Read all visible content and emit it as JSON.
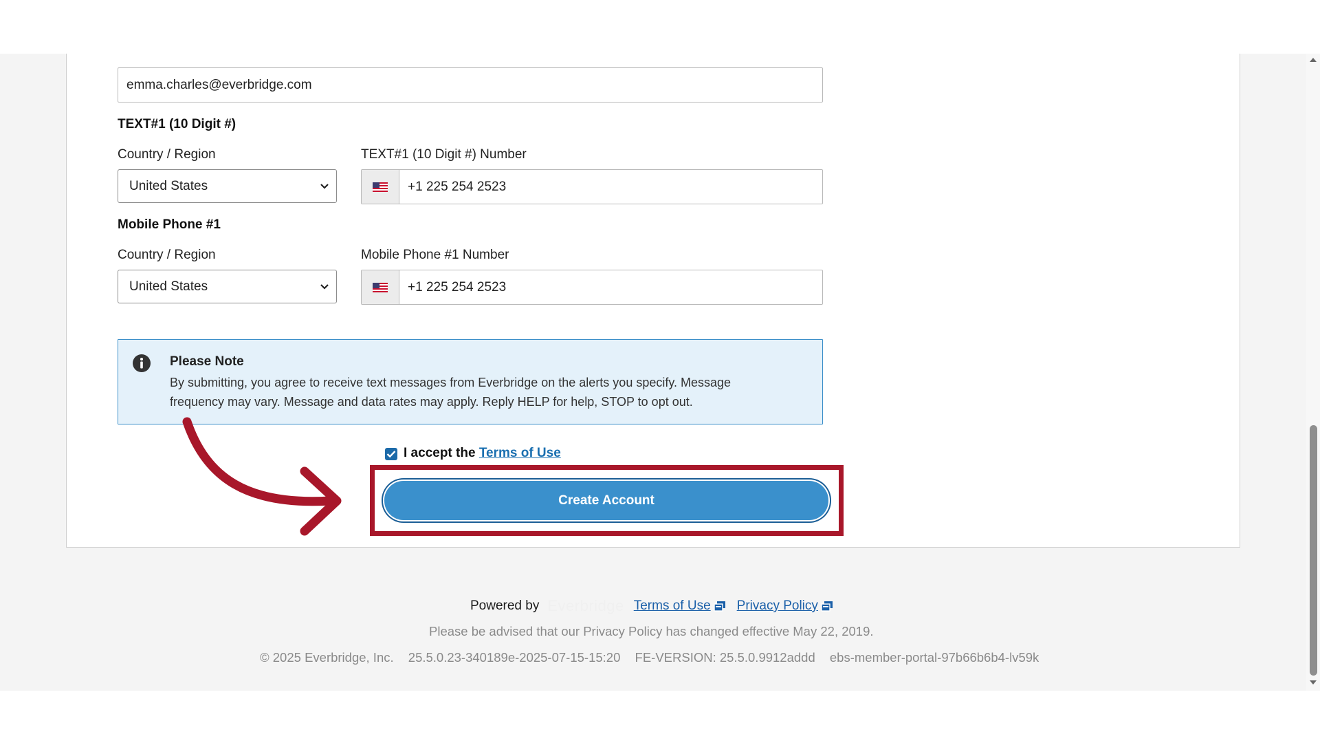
{
  "form": {
    "email_value": "emma.charles@everbridge.com",
    "text1": {
      "section_title": "TEXT#1 (10 Digit #)",
      "country_label": "Country / Region",
      "country_value": "United States",
      "number_label": "TEXT#1 (10 Digit #) Number",
      "number_value": "+1 225 254 2523"
    },
    "mobile1": {
      "section_title": "Mobile Phone #1",
      "country_label": "Country / Region",
      "country_value": "United States",
      "number_label": "Mobile Phone #1 Number",
      "number_value": "+1 225 254 2523"
    },
    "note": {
      "icon": "info-icon",
      "title": "Please Note",
      "text_line1": "By submitting, you agree to receive text messages from Everbridge on the alerts you specify. Message",
      "text_line2": "frequency may vary. Message and data rates may apply. Reply HELP for help, STOP to opt out."
    },
    "terms": {
      "checked": true,
      "prefix": "I accept the",
      "link_label": "Terms of Use"
    },
    "submit_label": "Create Account"
  },
  "annotation": {
    "arrow_color": "#a8172a",
    "highlight_color": "#a8172a"
  },
  "footer": {
    "powered_by": "Powered by",
    "logo_text": "Everbridge",
    "terms_link": "Terms of Use",
    "privacy_link": "Privacy Policy",
    "privacy_notice": "Please be advised that our Privacy Policy has changed effective May 22, 2019.",
    "copyright": "© 2025 Everbridge, Inc.",
    "build_version": "25.5.0.23-340189e-2025-07-15-15:20",
    "fe_version": "FE-VERSION: 25.5.0.9912addd",
    "pod_id": "ebs-member-portal-97b66b6b4-lv59k"
  },
  "colors": {
    "primary_button": "#3a90cc",
    "link": "#1a5fa8",
    "note_background": "#e4f1fa",
    "note_border": "#3b8fc9"
  }
}
